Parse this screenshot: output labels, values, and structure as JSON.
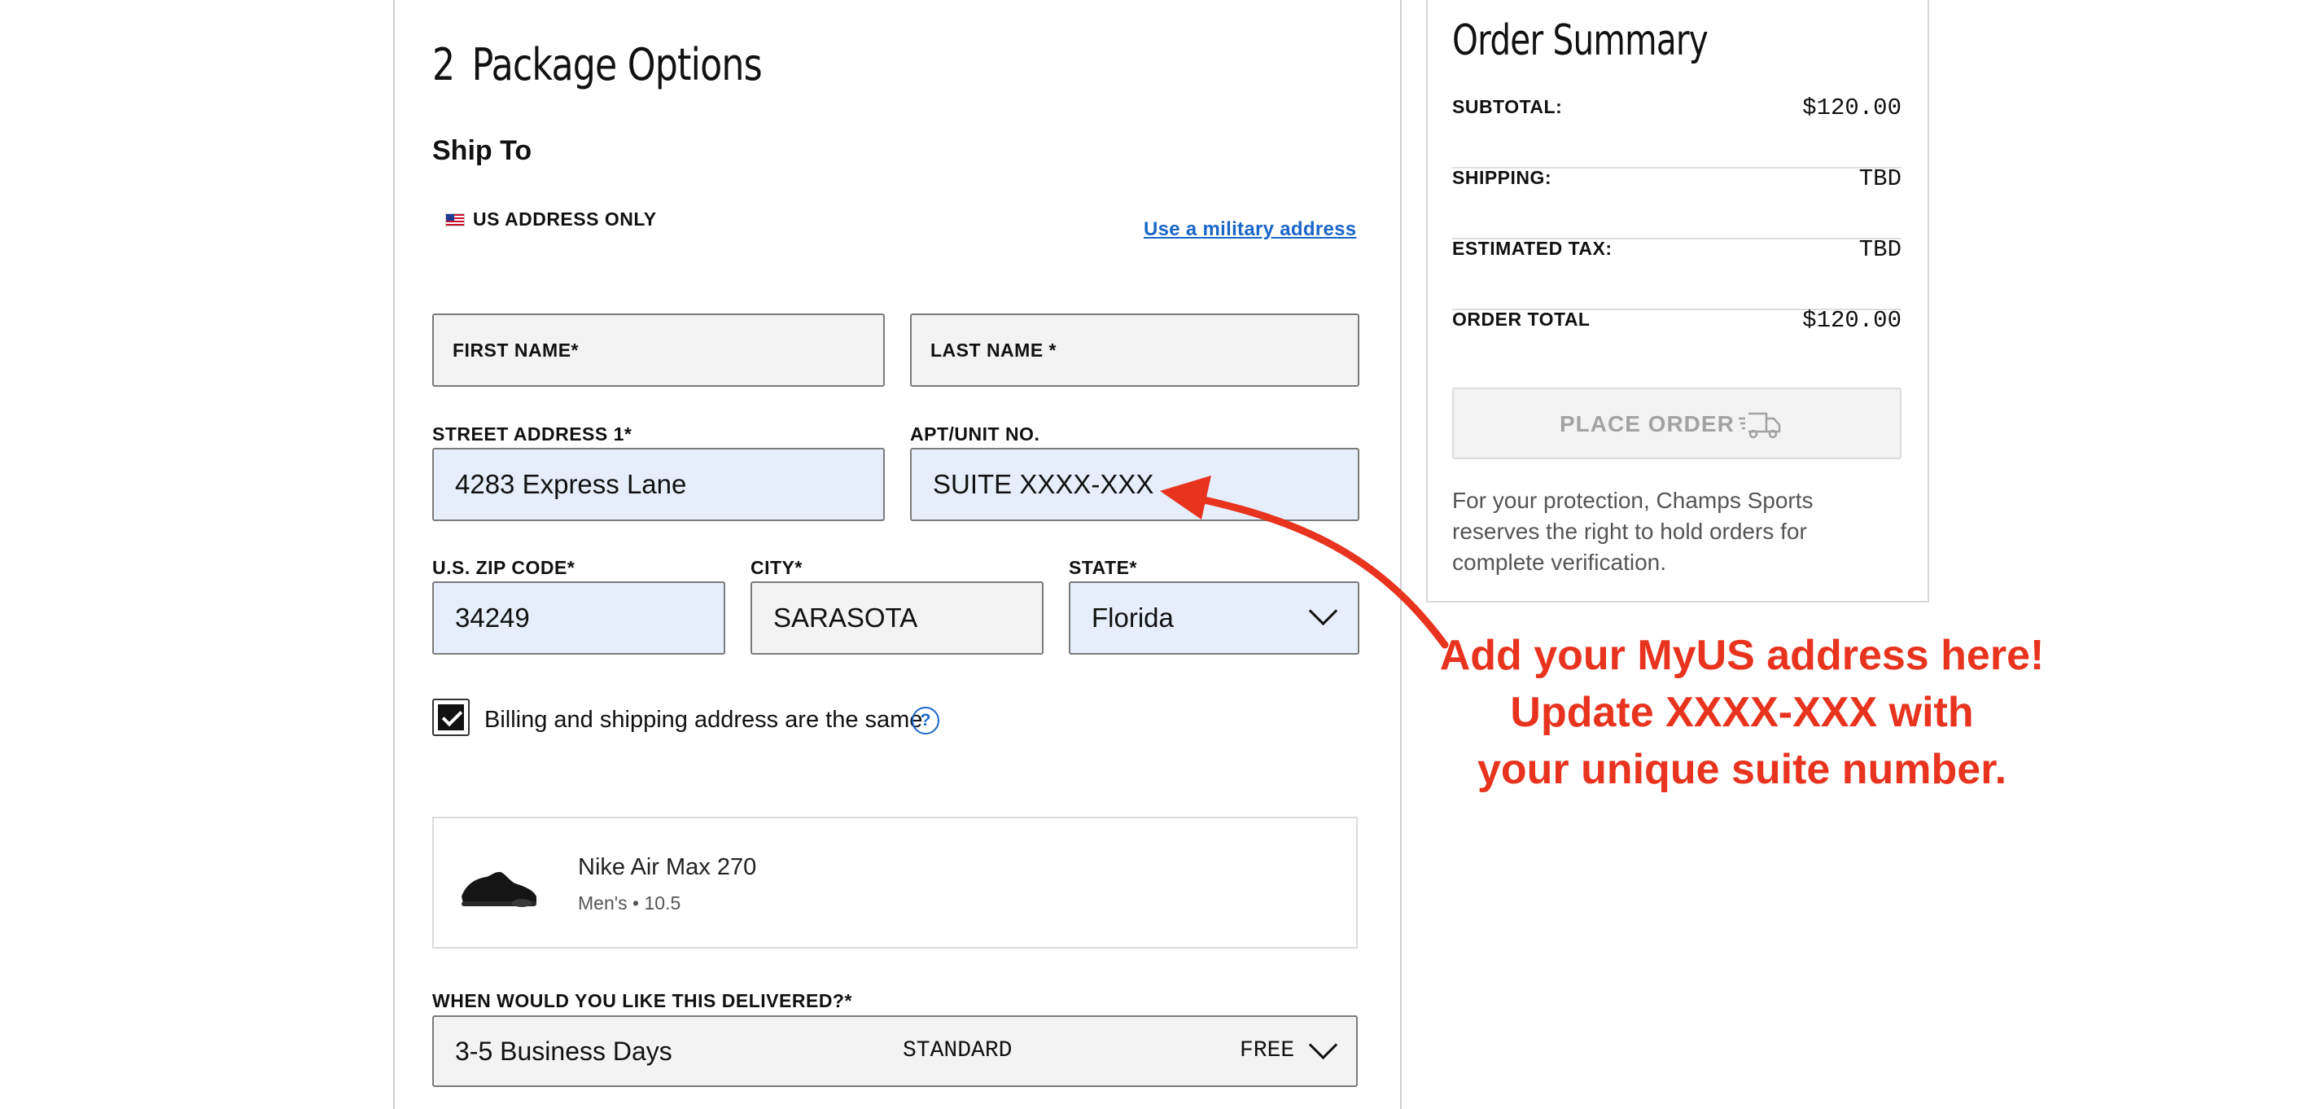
{
  "checkout": {
    "step_number": "2",
    "step_title": "Package Options",
    "ship_to": "Ship To",
    "us_only": "US ADDRESS ONLY",
    "military_link": "Use a military address",
    "fields": {
      "first_name_label": "FIRST NAME*",
      "last_name_label": "LAST NAME *",
      "street_label": "STREET ADDRESS 1*",
      "street_value": "4283 Express Lane",
      "apt_label": "APT/UNIT NO.",
      "apt_value": "SUITE XXXX-XXX",
      "zip_label": "U.S. ZIP CODE*",
      "zip_value": "34249",
      "city_label": "CITY*",
      "city_value": "SARASOTA",
      "state_label": "STATE*",
      "state_value": "Florida"
    },
    "billing_same": "Billing and shipping address are the same",
    "billing_checked": true,
    "help_glyph": "?",
    "product": {
      "name": "Nike Air Max 270",
      "gender": "Men's",
      "separator": "•",
      "size": "10.5"
    },
    "delivery": {
      "label": "WHEN WOULD YOU LIKE THIS DELIVERED?*",
      "window": "3-5 Business Days",
      "method": "STANDARD",
      "price": "FREE"
    }
  },
  "summary": {
    "title": "Order Summary",
    "rows": [
      {
        "label": "SUBTOTAL:",
        "value": "$120.00"
      },
      {
        "label": "SHIPPING:",
        "value": "TBD"
      },
      {
        "label": "ESTIMATED TAX:",
        "value": "TBD"
      },
      {
        "label": "ORDER TOTAL",
        "value": "$120.00"
      }
    ],
    "place_order": "PLACE ORDER",
    "protection": "For your protection, Champs Sports reserves the right to hold orders for complete verification."
  },
  "annotation": {
    "line1": "Add your MyUS address here!",
    "line2": "Update XXXX-XXX with",
    "line3": "your unique suite number.",
    "color": "#e8331e"
  },
  "icons": {
    "flag": "us-flag-icon",
    "chevron": "chevron-down-icon",
    "truck": "truck-icon",
    "help": "help-circle-icon",
    "shoe": "shoe-thumbnail"
  },
  "colors": {
    "link": "#1a66c8",
    "filled_field": "#e6eefc",
    "empty_field": "#f3f3f3"
  }
}
